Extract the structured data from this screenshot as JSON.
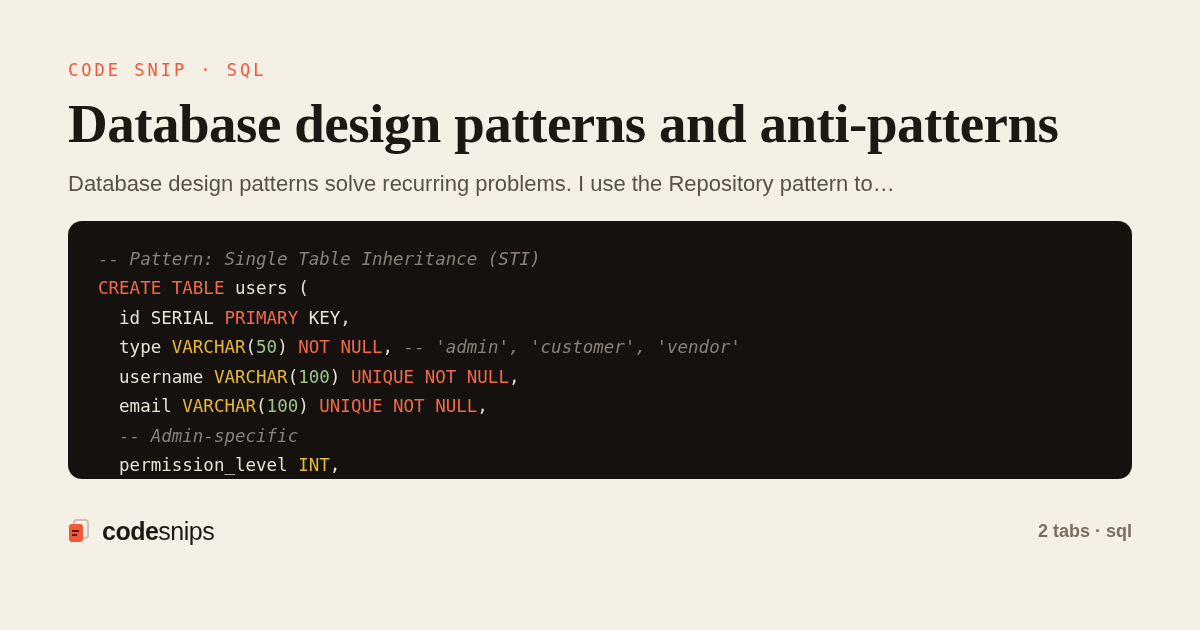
{
  "eyebrow": "CODE SNIP · SQL",
  "title": "Database design patterns and anti-patterns",
  "summary": "Database design patterns solve recurring problems. I use the Repository pattern to…",
  "code_lines": [
    [
      {
        "kind": "comment",
        "text": "-- Pattern: Single Table Inheritance (STI)"
      }
    ],
    [
      {
        "kind": "keyword",
        "text": "CREATE TABLE"
      },
      {
        "kind": "plain",
        "text": " users ("
      }
    ],
    [
      {
        "kind": "plain",
        "text": "  id SERIAL "
      },
      {
        "kind": "keyword",
        "text": "PRIMARY"
      },
      {
        "kind": "plain",
        "text": " KEY,"
      }
    ],
    [
      {
        "kind": "plain",
        "text": "  type "
      },
      {
        "kind": "type",
        "text": "VARCHAR"
      },
      {
        "kind": "plain",
        "text": "("
      },
      {
        "kind": "number",
        "text": "50"
      },
      {
        "kind": "plain",
        "text": ") "
      },
      {
        "kind": "keyword",
        "text": "NOT NULL"
      },
      {
        "kind": "plain",
        "text": ", "
      },
      {
        "kind": "comment",
        "text": "-- 'admin', 'customer', 'vendor'"
      }
    ],
    [
      {
        "kind": "plain",
        "text": "  username "
      },
      {
        "kind": "type",
        "text": "VARCHAR"
      },
      {
        "kind": "plain",
        "text": "("
      },
      {
        "kind": "number",
        "text": "100"
      },
      {
        "kind": "plain",
        "text": ") "
      },
      {
        "kind": "keyword",
        "text": "UNIQUE NOT NULL"
      },
      {
        "kind": "plain",
        "text": ","
      }
    ],
    [
      {
        "kind": "plain",
        "text": "  email "
      },
      {
        "kind": "type",
        "text": "VARCHAR"
      },
      {
        "kind": "plain",
        "text": "("
      },
      {
        "kind": "number",
        "text": "100"
      },
      {
        "kind": "plain",
        "text": ") "
      },
      {
        "kind": "keyword",
        "text": "UNIQUE NOT NULL"
      },
      {
        "kind": "plain",
        "text": ","
      }
    ],
    [
      {
        "kind": "comment",
        "text": "  -- Admin-specific"
      }
    ],
    [
      {
        "kind": "plain",
        "text": "  permission_level "
      },
      {
        "kind": "type",
        "text": "INT"
      },
      {
        "kind": "plain",
        "text": ","
      }
    ]
  ],
  "footer": {
    "brand": "**code**snips",
    "meta": "2 tabs · sql"
  }
}
